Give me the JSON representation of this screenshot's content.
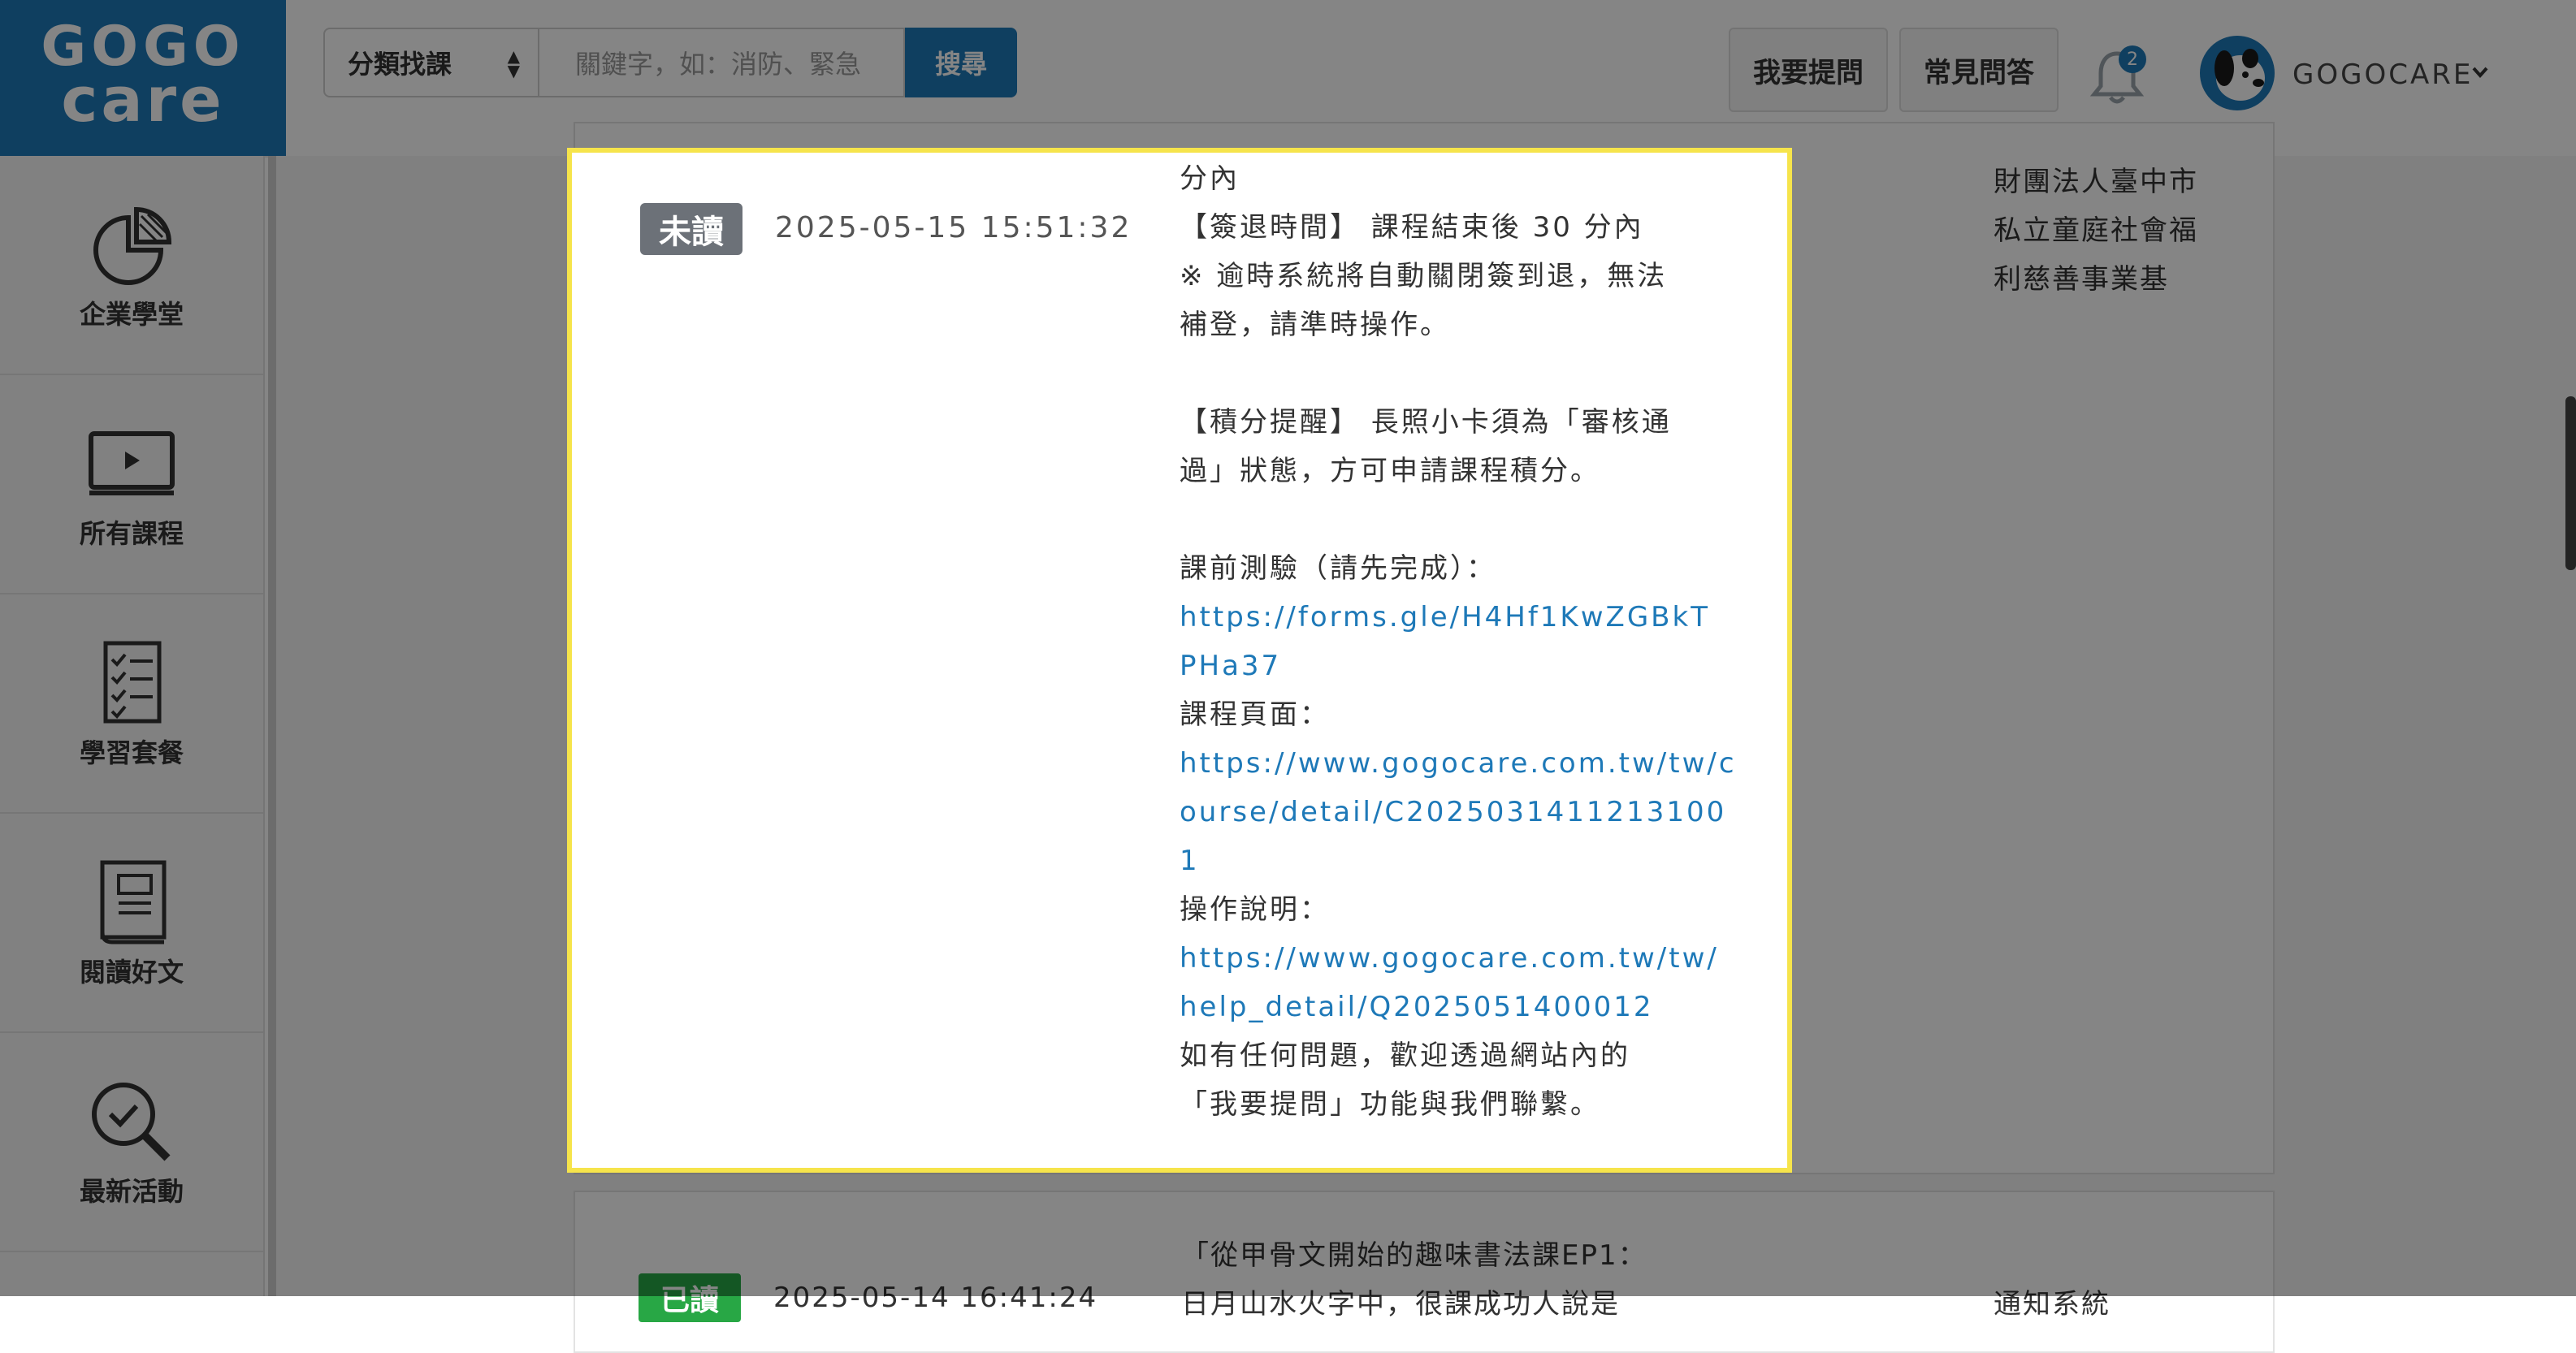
{
  "header": {
    "logo_line1": "GOGO",
    "logo_line2": "care",
    "category_select": "分類找課",
    "search_placeholder": "關鍵字，如：消防、緊急",
    "search_button": "搜尋",
    "ask_button": "我要提問",
    "faq_button": "常見問答",
    "notification_count": "2",
    "user_name": "GOGOCARE"
  },
  "sidebar": {
    "items": [
      {
        "label": "企業學堂",
        "icon": "pie-chart-icon"
      },
      {
        "label": "所有課程",
        "icon": "monitor-play-icon"
      },
      {
        "label": "學習套餐",
        "icon": "checklist-icon"
      },
      {
        "label": "閱讀好文",
        "icon": "book-icon"
      },
      {
        "label": "最新活動",
        "icon": "magnifier-check-icon"
      }
    ]
  },
  "background": {
    "org_lines": [
      "財團法人臺中市",
      "私立童庭社會福",
      "利慈善事業基"
    ],
    "next_title_line1": "「從甲骨文開始的趣味書法課EP1：",
    "next_title_line2": "日月山水火字中，很課成功人說是",
    "next_status": "已讀",
    "next_time": "2025-05-14 16:41:24",
    "next_sender": "通知系統"
  },
  "modal": {
    "status_badge": "未讀",
    "timestamp": "2025-05-15 15:51:32",
    "lines": [
      {
        "text": "分內",
        "type": "text"
      },
      {
        "text": "【簽退時間】 課程結束後 30 分內",
        "type": "text"
      },
      {
        "text": "※ 逾時系統將自動關閉簽到退，無法",
        "type": "text"
      },
      {
        "text": "補登，請準時操作。",
        "type": "text"
      },
      {
        "text": "",
        "type": "blank"
      },
      {
        "text": "【積分提醒】 長照小卡須為「審核通",
        "type": "text"
      },
      {
        "text": "過」狀態，方可申請課程積分。",
        "type": "text"
      },
      {
        "text": "",
        "type": "blank"
      },
      {
        "text": "課前測驗（請先完成）：",
        "type": "text"
      },
      {
        "text": "https://forms.gle/H4Hf1KwZGBkT",
        "type": "link"
      },
      {
        "text": "PHa37",
        "type": "link"
      },
      {
        "text": "課程頁面：",
        "type": "text"
      },
      {
        "text": "https://www.gogocare.com.tw/tw/c",
        "type": "link"
      },
      {
        "text": "ourse/detail/C2025031411213100",
        "type": "link"
      },
      {
        "text": "1",
        "type": "link"
      },
      {
        "text": "操作說明：",
        "type": "text"
      },
      {
        "text": "https://www.gogocare.com.tw/tw/",
        "type": "link"
      },
      {
        "text": "help_detail/Q2025051400012",
        "type": "link"
      },
      {
        "text": "如有任何問題，歡迎透過網站內的",
        "type": "text"
      },
      {
        "text": "「我要提問」功能與我們聯繫。",
        "type": "text"
      }
    ]
  },
  "colors": {
    "brand": "#1e79b8",
    "modal_border": "#f6e44b",
    "unread_badge": "#6c7178",
    "read_badge": "#28a745"
  }
}
